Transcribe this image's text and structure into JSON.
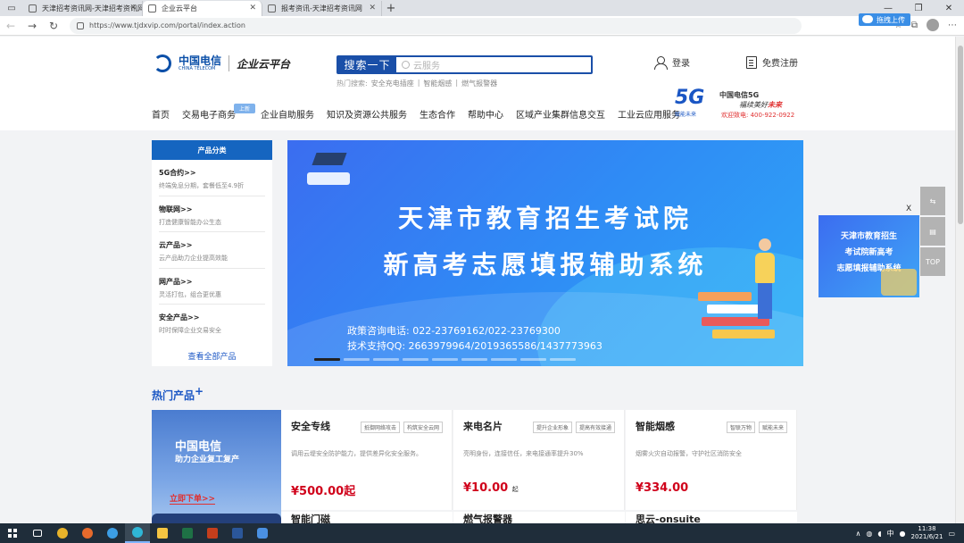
{
  "browser": {
    "tabs": [
      {
        "title": "天津招考资讯网-天津招考资讯网",
        "active": false
      },
      {
        "title": "企业云平台",
        "active": true
      },
      {
        "title": "报考资讯-天津招考资讯网",
        "active": false
      }
    ],
    "url": "https://www.tjdxvip.com/portal/index.action",
    "baidu_upload_label": "拖拽上传"
  },
  "header": {
    "logo_brand": "中国电信",
    "logo_brand_en": "CHINA TELECOM",
    "logo_product": "企业云平台",
    "search_button": "搜索一下",
    "search_placeholder": "云服务",
    "hot_label": "热门搜索:",
    "hot_terms": [
      "安全充电插座",
      "智能烟感",
      "燃气报警器"
    ],
    "login": "登录",
    "register": "免费注册"
  },
  "nav": {
    "items": [
      "首页",
      "交易电子商务",
      "企业自助服务",
      "知识及资源公共服务",
      "生态合作",
      "帮助中心",
      "区域产业集群信息交互",
      "工业云应用服务"
    ],
    "badge": "上新"
  },
  "promo5g": {
    "big": "5G",
    "sub": "赋能未来",
    "line1": "中国电信5G",
    "line2_a": "福续美好",
    "line2_b": "未来",
    "line3": "欢迎致电: 400-922-0922"
  },
  "categories": {
    "title": "产品分类",
    "items": [
      {
        "title": "5G合约>>",
        "desc": "终端免息分期，套餐低至4.9折"
      },
      {
        "title": "物联网>>",
        "desc": "打造健康智能办公生态"
      },
      {
        "title": "云产品>>",
        "desc": "云产品助力企业提高效能"
      },
      {
        "title": "网产品>>",
        "desc": "灵活打包，组合更优惠"
      },
      {
        "title": "安全产品>>",
        "desc": "时时保障企业交易安全"
      }
    ],
    "view_all": "查看全部产品"
  },
  "banner": {
    "line1": "天津市教育招生考试院",
    "line2": "新高考志愿填报辅助系统",
    "phone": "政策咨询电话: 022-23769162/022-23769300",
    "qq": "技术支持QQ: 2663979964/2019365586/1437773963",
    "slide_count": 9,
    "active_slide": 0
  },
  "hot_products": {
    "title": "热门产品",
    "promo_line1": "中国电信",
    "promo_line2": "助力企业复工复产",
    "promo_button": "立即下单>>",
    "items": [
      {
        "name": "安全专线",
        "tags": [
          "抵御网络攻击",
          "构筑安全云网"
        ],
        "desc": "调用云堤安全防护能力，提供差异化安全服务。",
        "price": "¥500.00起",
        "unit": ""
      },
      {
        "name": "来电名片",
        "tags": [
          "提升企业形象",
          "提高有效接通"
        ],
        "desc": "亮明身份，连接信任，来电接通率提升30%",
        "price": "¥10.00",
        "unit": "起"
      },
      {
        "name": "智能烟感",
        "tags": [
          "智联万物",
          "赋能未来"
        ],
        "desc": "烟雾火灾自动报警，守护社区消防安全",
        "price": "¥334.00",
        "unit": ""
      }
    ],
    "row2": [
      "智能门磁",
      "燃气报警器",
      "思云-onsuite"
    ]
  },
  "float_ad": {
    "close": "X",
    "lines": [
      "天津市教育招生",
      "考试院新高考",
      "志愿填报辅助系统"
    ]
  },
  "side_tools": [
    "share-icon",
    "message-icon",
    "TOP"
  ],
  "taskbar": {
    "time": "11:38",
    "date": "2021/6/21",
    "ime": "中"
  }
}
